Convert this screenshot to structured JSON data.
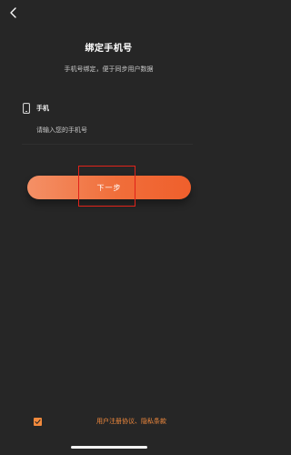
{
  "header": {
    "back_icon": "chevron-left-icon",
    "title": "绑定手机号",
    "subtitle": "手机号绑定，便于同步用户数据"
  },
  "form": {
    "phone_label": "手机",
    "phone_icon": "mobile-phone-icon",
    "phone_placeholder": "请输入您的手机号",
    "phone_value": ""
  },
  "actions": {
    "next_label": "下一步"
  },
  "agreement": {
    "checked": true,
    "user_agreement": "用户注册协议",
    "separator": "、",
    "privacy_policy": "隐私条款"
  },
  "colors": {
    "background": "#262626",
    "accent": "#f28a3d",
    "button_gradient_start": "#f49066",
    "button_gradient_end": "#ef5f2c",
    "highlight": "#e0231a"
  }
}
